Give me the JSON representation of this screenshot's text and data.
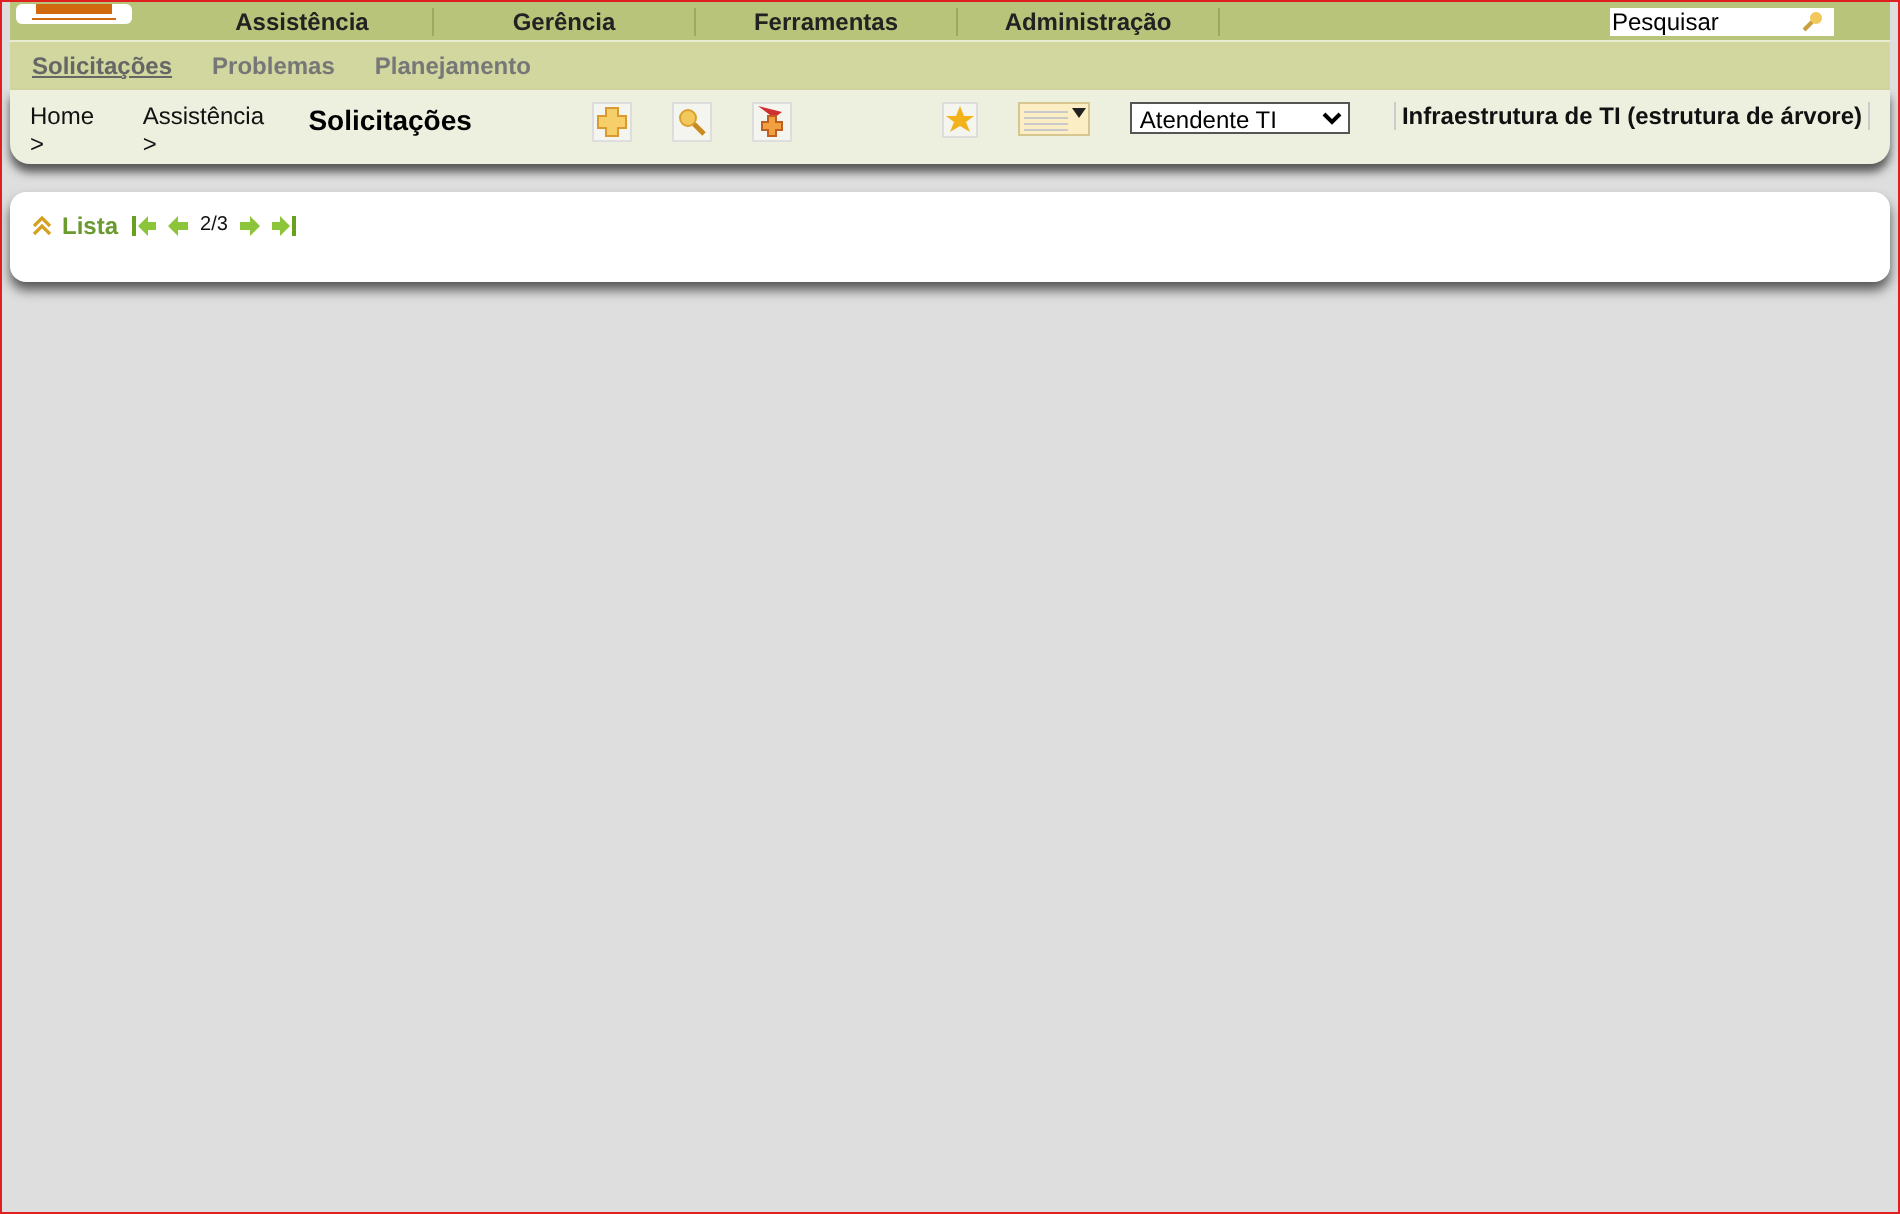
{
  "main_menu": [
    {
      "label": "Assistência",
      "selected": false
    },
    {
      "label": "Gerência",
      "selected": false
    },
    {
      "label": "Ferramentas",
      "selected": false
    },
    {
      "label": "Administração",
      "selected": false
    }
  ],
  "search": {
    "placeholder": "Pesquisar"
  },
  "sub_menu": [
    {
      "label": "Solicitações",
      "selected": true
    },
    {
      "label": "Problemas",
      "selected": false
    },
    {
      "label": "Planejamento",
      "selected": false
    }
  ],
  "breadcrumb": [
    "Home >",
    "Assistência >"
  ],
  "page_title": "Solicitações",
  "role_select": {
    "value": "Atendente TI"
  },
  "tree_link": "Infraestrutura de TI (estrutura de árvore)",
  "list": {
    "label": "Lista",
    "page": "2/3"
  }
}
